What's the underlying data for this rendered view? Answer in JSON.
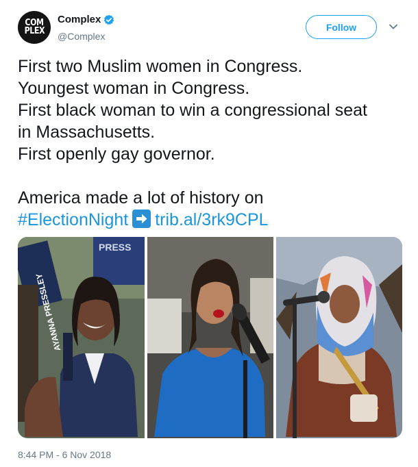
{
  "user": {
    "avatar_text_top": "COM",
    "avatar_text_bottom": "PLEX",
    "display_name": "Complex",
    "handle": "@Complex",
    "verified": true
  },
  "follow_label": "Follow",
  "tweet": {
    "lines": [
      "First two Muslim women in Congress.",
      "Youngest woman in Congress.",
      "First black woman to win a congressional seat",
      "in Massachusetts.",
      "First openly gay governor."
    ],
    "closing_text": "America made a lot of history on",
    "hashtag": "#ElectionNight",
    "link": "trib.al/3rk9CPL"
  },
  "media": {
    "photos": [
      {
        "subject": "woman-smiling-campaign-signs",
        "sign_text": "AYANNA PRESSLEY",
        "press_text": "PRESS"
      },
      {
        "subject": "woman-blue-dress-microphone"
      },
      {
        "subject": "woman-headscarf-microphone"
      }
    ]
  },
  "timestamp": "8:44 PM - 6 Nov 2018",
  "colors": {
    "accent": "#1da1f2",
    "link": "#1b95e0",
    "muted": "#657786",
    "text": "#14171a"
  }
}
